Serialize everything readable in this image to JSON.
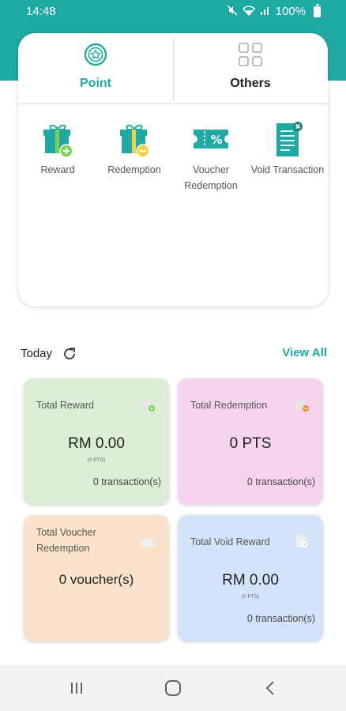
{
  "status_bar": {
    "time": "14:48",
    "battery": "100%"
  },
  "tabs": [
    {
      "label": "Point",
      "icon": "star-badge-icon",
      "active": true
    },
    {
      "label": "Others",
      "icon": "grid-icon",
      "active": false
    }
  ],
  "actions": [
    {
      "label": "Reward",
      "icon": "gift-plus-icon"
    },
    {
      "label": "Redemption",
      "icon": "gift-minus-icon"
    },
    {
      "label_line1": "Voucher",
      "label_line2": "Redemption",
      "icon": "voucher-percent-icon"
    },
    {
      "label": "Void Transaction",
      "icon": "void-receipt-icon"
    }
  ],
  "today": {
    "label": "Today",
    "view_all": "View All"
  },
  "stats": {
    "reward": {
      "title": "Total Reward",
      "value": "RM 0.00",
      "sub": "(0 PTS)",
      "transactions": "0 transaction(s)",
      "color": "#dbeed6"
    },
    "redemption": {
      "title": "Total Redemption",
      "value": "0 PTS",
      "transactions": "0 transaction(s)",
      "color": "#f6d4ed"
    },
    "voucher": {
      "title_line1": "Total Voucher",
      "title_line2": "Redemption",
      "value": "0 voucher(s)",
      "color": "#fae3ca"
    },
    "void": {
      "title": "Total Void Reward",
      "value": "RM 0.00",
      "sub": "(0 PTS)",
      "transactions": "0 transaction(s)",
      "color": "#d2e3fa"
    }
  },
  "colors": {
    "accent": "#1fa9a4",
    "gift_green": "#7bd155",
    "gift_yellow": "#f2d24a"
  }
}
